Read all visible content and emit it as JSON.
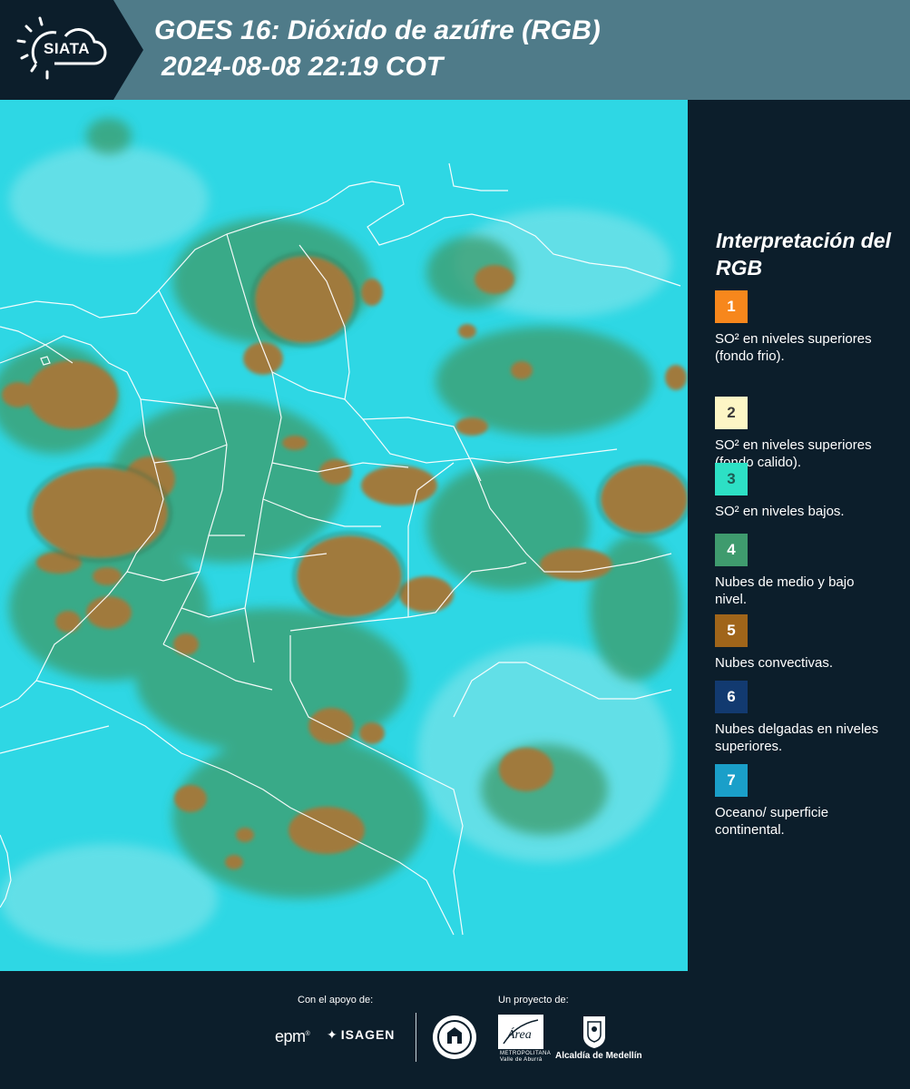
{
  "header": {
    "logo_text": "SIATA",
    "title_line1": "GOES 16: Dióxido de azúfre (RGB)",
    "title_line2": "2024-08-08 22:19 COT"
  },
  "legend": {
    "title": "Interpretación del RGB",
    "items": [
      {
        "number": "1",
        "color": "#f7871c",
        "text_color": "#ffffff",
        "description": "SO² en niveles superiores (fondo frio)."
      },
      {
        "number": "2",
        "color": "#fdf6c5",
        "text_color": "#3a3a3a",
        "description": "SO² en niveles superiores (fondo calido)."
      },
      {
        "number": "3",
        "color": "#2de0c5",
        "text_color": "#1d5a52",
        "description": "SO² en niveles bajos."
      },
      {
        "number": "4",
        "color": "#3f9b6e",
        "text_color": "#ffffff",
        "description": "Nubes de medio y bajo nivel."
      },
      {
        "number": "5",
        "color": "#a0651a",
        "text_color": "#ffffff",
        "description": "Nubes convectivas."
      },
      {
        "number": "6",
        "color": "#123a70",
        "text_color": "#ffffff",
        "description": "Nubes delgadas en niveles superiores."
      },
      {
        "number": "7",
        "color": "#1a9fc9",
        "text_color": "#ffffff",
        "description": "Oceano/ superficie continental."
      }
    ]
  },
  "footer": {
    "support_label": "Con el apoyo de:",
    "project_label": "Un proyecto de:",
    "sponsor1": "epm",
    "sponsor2": "ISAGEN",
    "partner1": "Área",
    "partner1_caption": "METROPOLITANA",
    "partner1_subcaption": "Valle de Aburrá",
    "partner2": "Alcaldía de Medellín"
  },
  "colors": {
    "header_bg": "#4f7b89",
    "logo_bg": "#0c1e2b",
    "panel_bg": "#0c1e2b",
    "map_background": "#2ed7e4",
    "cloud_convective": "#a07a3c",
    "cloud_low": "#3d9b6a",
    "boundary_lines": "#ffffff"
  }
}
